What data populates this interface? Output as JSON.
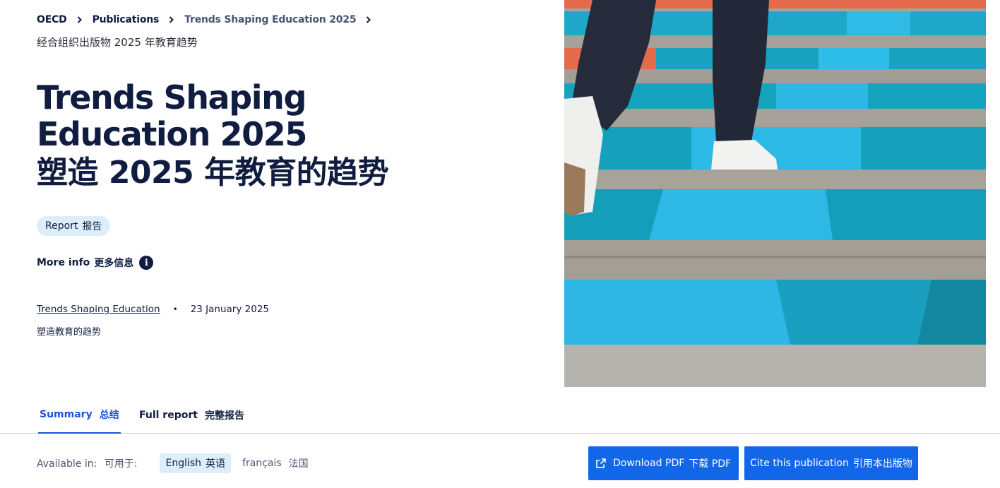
{
  "breadcrumb": {
    "items": [
      "OECD",
      "Publications",
      "Trends Shaping Education 2025"
    ]
  },
  "subtitle_cn": "经合组织出版物 2025 年教育趋势",
  "title": {
    "en": "Trends Shaping Education 2025",
    "zh": "塑造 2025 年教育的趋势"
  },
  "badge": {
    "en": "Report",
    "cn": "报告"
  },
  "more_info": {
    "en": "More info",
    "cn": "更多信息",
    "icon": "info-icon"
  },
  "meta": {
    "series": "Trends Shaping Education",
    "separator": "•",
    "date": "23 January 2025",
    "series_cn": "塑造教育的趋势"
  },
  "hero_image": {
    "subject": "person-walking-up-colorful-stairs"
  },
  "tabs": [
    {
      "en": "Summary",
      "cn": "总结",
      "active": true
    },
    {
      "en": "Full report",
      "cn": "完整报告",
      "active": false
    }
  ],
  "available": {
    "label": "Available in:",
    "label_cn": "可用于:",
    "languages": [
      {
        "en": "English",
        "cn": "英语",
        "active": true
      },
      {
        "en": "français",
        "cn": "法国",
        "active": false
      }
    ]
  },
  "buttons": {
    "download": {
      "en": "Download PDF",
      "cn": "下载 PDF",
      "icon": "external-link-icon"
    },
    "cite": {
      "en": "Cite this publication",
      "cn": "引用本出版物"
    }
  },
  "colors": {
    "navy": "#101d40",
    "accent_blue": "#1167e8",
    "badge_bg": "#ddeefb"
  }
}
